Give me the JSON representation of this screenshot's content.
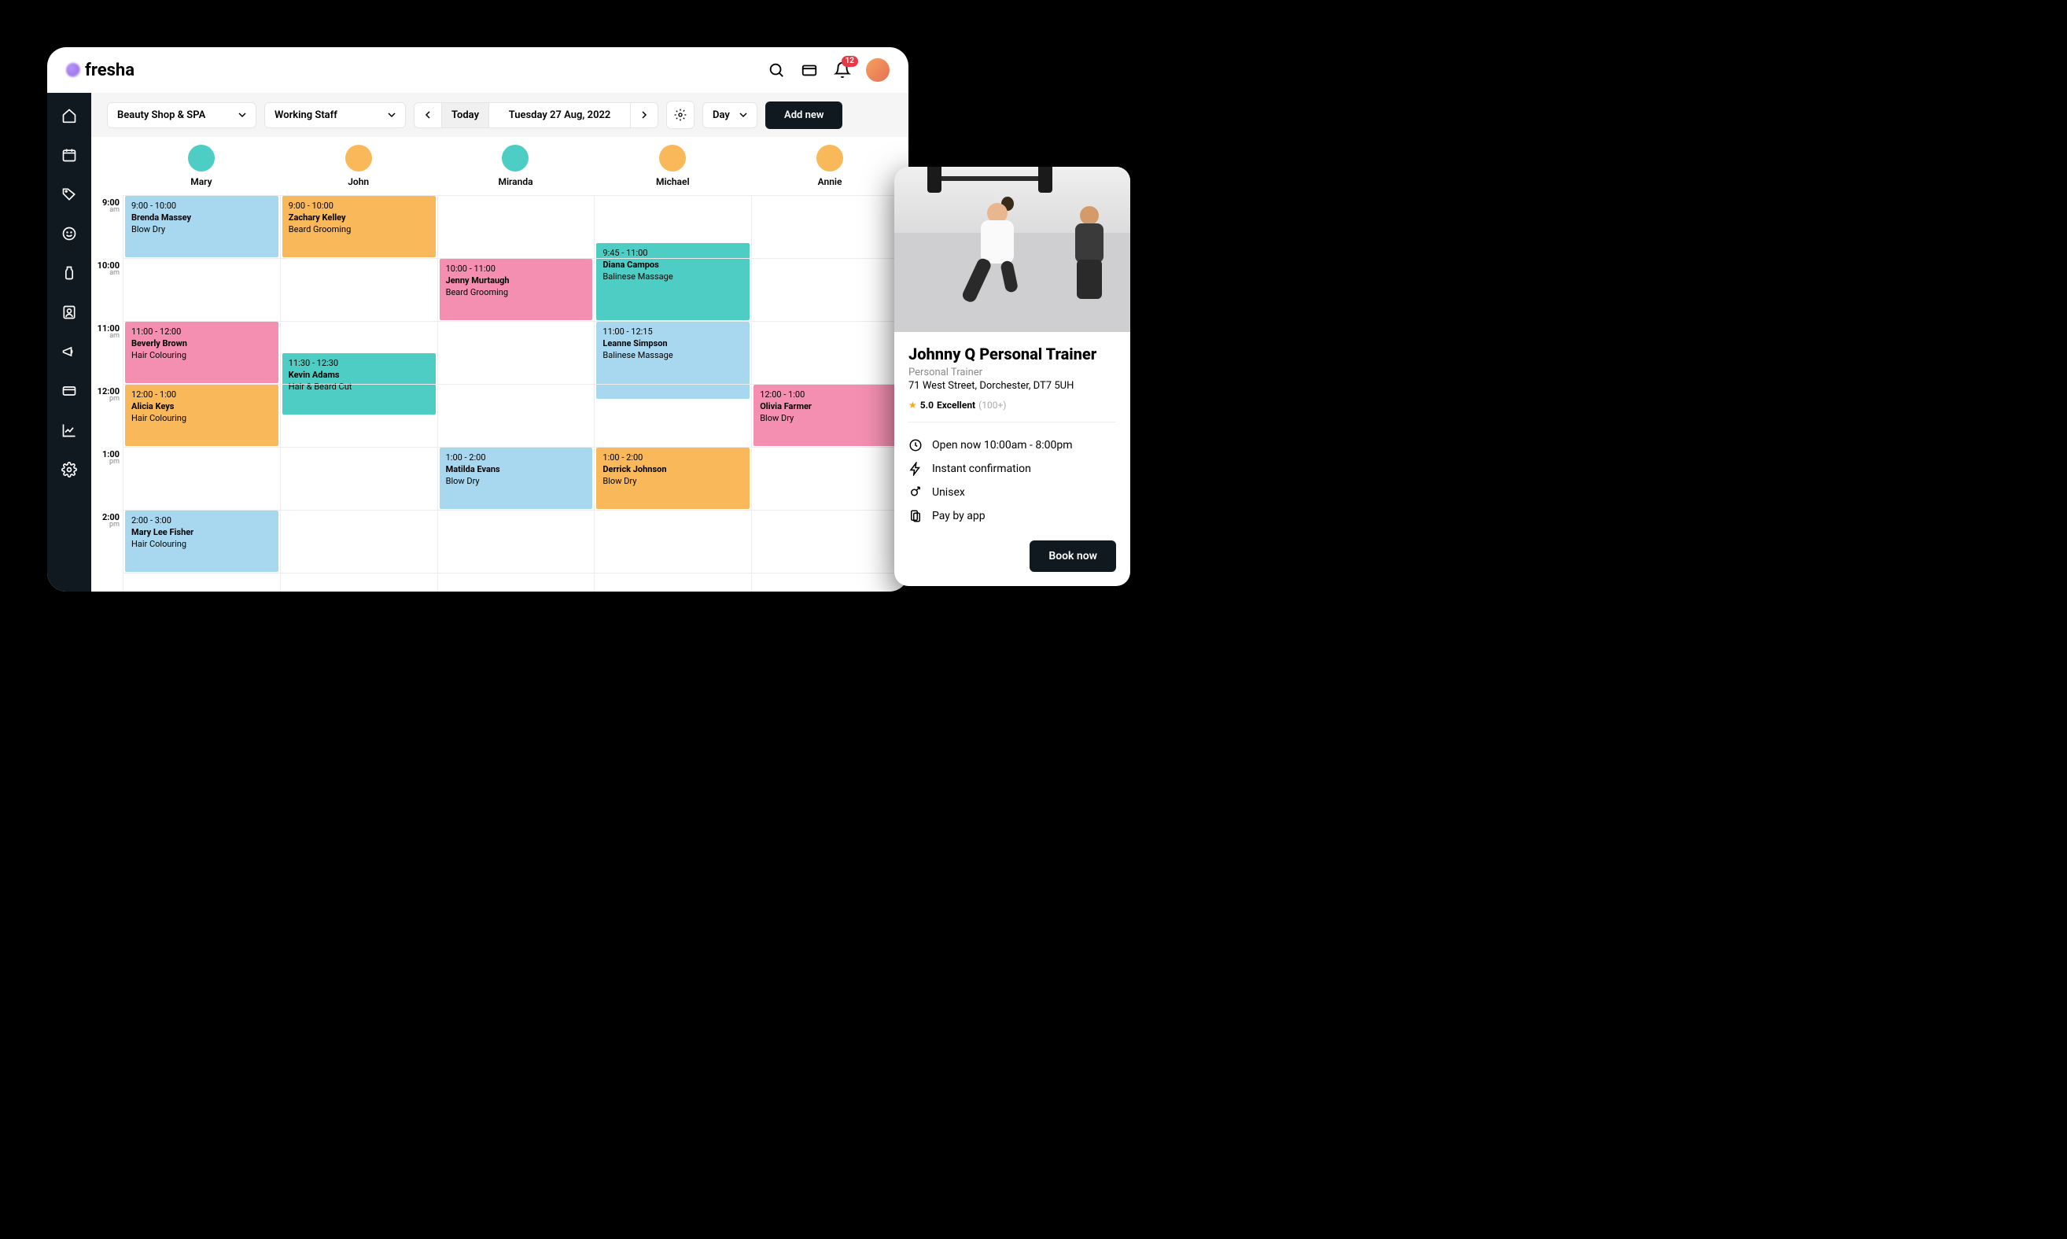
{
  "header": {
    "logo_text": "fresha",
    "notification_count": "12"
  },
  "sidebar": {
    "items": [
      "home",
      "calendar",
      "tag",
      "smile",
      "bottle",
      "user",
      "megaphone",
      "card",
      "chart",
      "settings"
    ]
  },
  "toolbar": {
    "location": "Beauty Shop & SPA",
    "staff_filter": "Working Staff",
    "today_label": "Today",
    "date_label": "Tuesday 27 Aug, 2022",
    "view_label": "Day",
    "add_label": "Add new"
  },
  "staff": [
    {
      "name": "Mary",
      "color": "#4ecdc4"
    },
    {
      "name": "John",
      "color": "#f9b859"
    },
    {
      "name": "Miranda",
      "color": "#4ecdc4"
    },
    {
      "name": "Michael",
      "color": "#f9b859"
    },
    {
      "name": "Annie",
      "color": "#f9b859"
    }
  ],
  "time_slots": [
    {
      "label": "9:00",
      "ampm": "am"
    },
    {
      "label": "10:00",
      "ampm": "am"
    },
    {
      "label": "11:00",
      "ampm": "am"
    },
    {
      "label": "12:00",
      "ampm": "pm"
    },
    {
      "label": "1:00",
      "ampm": "pm"
    },
    {
      "label": "2:00",
      "ampm": "pm"
    }
  ],
  "events": [
    {
      "col": 0,
      "start": 0,
      "dur": 1,
      "time": "9:00 - 10:00",
      "name": "Brenda Massey",
      "service": "Blow Dry",
      "color": "c-blue"
    },
    {
      "col": 1,
      "start": 0,
      "dur": 1,
      "time": "9:00 - 10:00",
      "name": "Zachary Kelley",
      "service": "Beard Grooming",
      "color": "c-orange"
    },
    {
      "col": 2,
      "start": 1,
      "dur": 1,
      "time": "10:00 - 11:00",
      "name": "Jenny Murtaugh",
      "service": "Beard Grooming",
      "color": "c-pink"
    },
    {
      "col": 3,
      "start": 0.75,
      "dur": 1.25,
      "time": "9:45 - 11:00",
      "name": "Diana Campos",
      "service": "Balinese Massage",
      "color": "c-teal"
    },
    {
      "col": 0,
      "start": 2,
      "dur": 1,
      "time": "11:00 - 12:00",
      "name": "Beverly Brown",
      "service": "Hair Colouring",
      "color": "c-pink"
    },
    {
      "col": 3,
      "start": 2,
      "dur": 1.25,
      "time": "11:00 - 12:15",
      "name": "Leanne Simpson",
      "service": "Balinese Massage",
      "color": "c-blue"
    },
    {
      "col": 1,
      "start": 2.5,
      "dur": 1,
      "time": "11:30 - 12:30",
      "name": "Kevin Adams",
      "service": "Hair & Beard Cut",
      "color": "c-teal"
    },
    {
      "col": 0,
      "start": 3,
      "dur": 1,
      "time": "12:00 - 1:00",
      "name": "Alicia Keys",
      "service": "Hair Colouring",
      "color": "c-orange"
    },
    {
      "col": 4,
      "start": 3,
      "dur": 1,
      "time": "12:00 - 1:00",
      "name": "Olivia Farmer",
      "service": "Blow Dry",
      "color": "c-pink"
    },
    {
      "col": 2,
      "start": 4,
      "dur": 1,
      "time": "1:00 - 2:00",
      "name": "Matilda Evans",
      "service": "Blow Dry",
      "color": "c-blue"
    },
    {
      "col": 3,
      "start": 4,
      "dur": 1,
      "time": "1:00 - 2:00",
      "name": "Derrick Johnson",
      "service": "Blow Dry",
      "color": "c-orange"
    },
    {
      "col": 0,
      "start": 5,
      "dur": 1,
      "time": "2:00 - 3:00",
      "name": "Mary Lee Fisher",
      "service": "Hair Colouring",
      "color": "c-blue"
    }
  ],
  "card": {
    "title": "Johnny Q Personal Trainer",
    "subtitle": "Personal Trainer",
    "address": "71 West Street, Dorchester, DT7 5UH",
    "rating_score": "5.0",
    "rating_label": "Excellent",
    "rating_count": "(100+)",
    "features": {
      "hours": "Open now 10:00am - 8:00pm",
      "confirm": "Instant confirmation",
      "unisex": "Unisex",
      "pay": "Pay by app"
    },
    "book_label": "Book now"
  }
}
